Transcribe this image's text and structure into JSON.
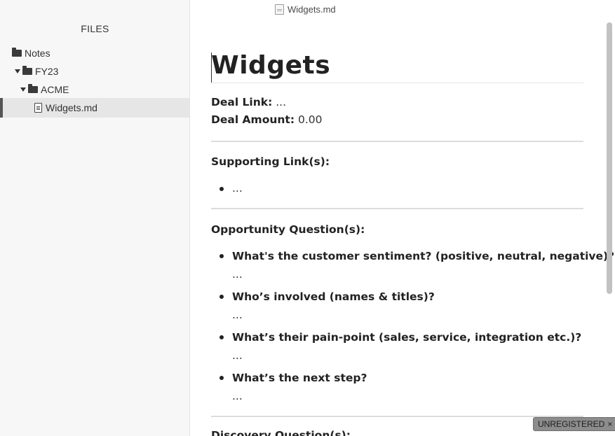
{
  "window": {
    "title": "Widgets.md"
  },
  "sidebar": {
    "header": "FILES",
    "items": [
      {
        "label": "Notes",
        "type": "folder",
        "level": 0,
        "expanded": false
      },
      {
        "label": "FY23",
        "type": "folder",
        "level": 1,
        "expanded": true
      },
      {
        "label": "ACME",
        "type": "folder",
        "level": 2,
        "expanded": true
      },
      {
        "label": "Widgets.md",
        "type": "file",
        "level": 3,
        "active": true
      }
    ]
  },
  "document": {
    "title": "Widgets",
    "deal_link_label": "Deal Link:",
    "deal_link_value": "...",
    "deal_amount_label": "Deal Amount:",
    "deal_amount_value": "0.00",
    "supporting_heading": "Supporting Link(s):",
    "supporting_items": [
      "..."
    ],
    "opportunity_heading": "Opportunity Question(s):",
    "questions": [
      {
        "q": "What's the customer sentiment? (positive, neutral, negative)?",
        "a": "..."
      },
      {
        "q": "Who’s involved (names & titles)?",
        "a": "..."
      },
      {
        "q": "What’s their pain-point (sales, service, integration etc.)?",
        "a": "..."
      },
      {
        "q": "What’s the next step?",
        "a": "..."
      }
    ],
    "discovery_heading": "Discovery Question(s):"
  },
  "badge": {
    "label": "UNREGISTERED",
    "close": "×"
  },
  "colors": {
    "sidebar_bg": "#f7f7f7",
    "active_item_bg": "#e6e6e6",
    "badge_bg": "#8c8c8c"
  }
}
